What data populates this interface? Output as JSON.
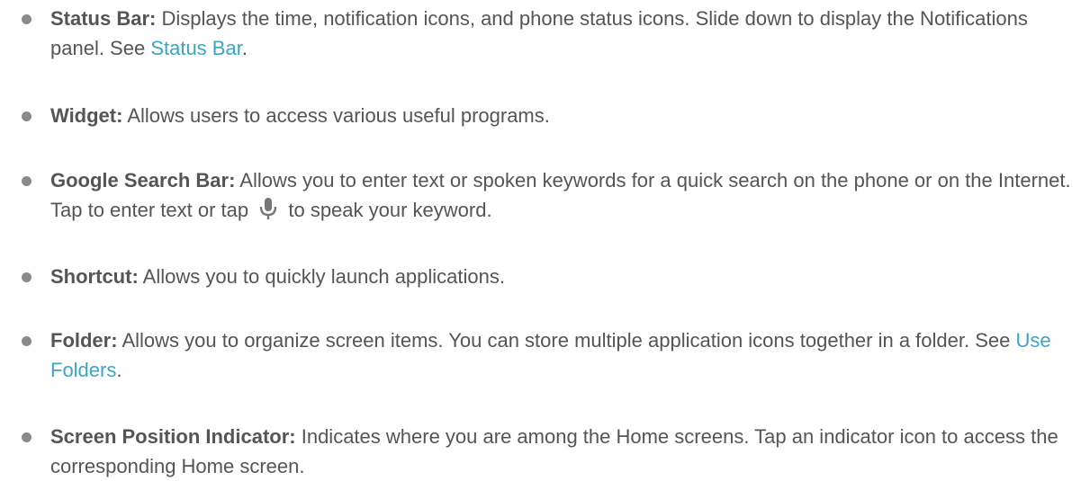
{
  "items": [
    {
      "term": "Status Bar:",
      "text_before": " Displays the time, notification icons, and phone status icons. Slide down to display the Notifications panel. See ",
      "link": "Status Bar",
      "text_after": "."
    },
    {
      "term": "Widget:",
      "text_before": " Allows users to access various useful programs."
    },
    {
      "term": "Google Search Bar:",
      "text_before": " Allows you to enter text or spoken keywords for a quick search on the phone or on the Internet. Tap to enter text or tap ",
      "icon": "microphone-icon",
      "text_after": " to speak your keyword."
    },
    {
      "term": "Shortcut:",
      "text_before": " Allows you to quickly launch applications."
    },
    {
      "term": "Folder:",
      "text_before": " Allows you to organize screen items. You can store multiple application icons together in a folder. See ",
      "link": "Use Folders",
      "text_after": "."
    },
    {
      "term": "Screen Position Indicator:",
      "text_before": " Indicates where you are among the Home screens. Tap an indicator icon to access the corresponding Home screen."
    }
  ],
  "colors": {
    "text": "#555555",
    "link": "#3aa6c4",
    "bullet": "#8a8a8a"
  }
}
